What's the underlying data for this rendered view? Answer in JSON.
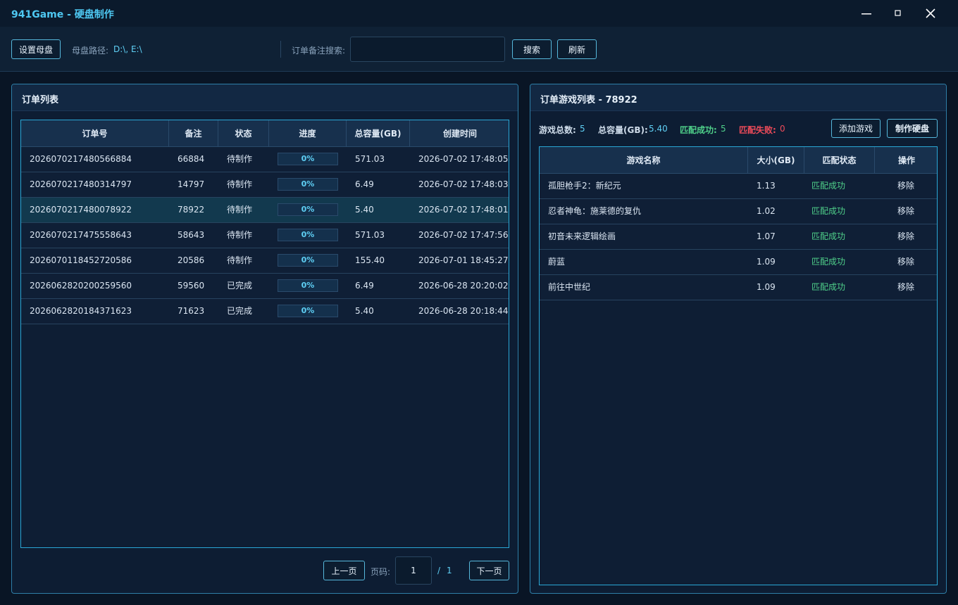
{
  "window": {
    "title": "941Game - 硬盘制作",
    "minimize_icon": "minimize-icon",
    "maximize_icon": "maximize-icon",
    "close_icon": "close-icon"
  },
  "toolbar": {
    "set_master_label": "设置母盘",
    "master_path_label": "母盘路径:",
    "master_path_value": "D:\\, E:\\",
    "search_label": "订单备注搜索:",
    "search_value": "",
    "search_button": "搜索",
    "refresh_button": "刷新"
  },
  "orders": {
    "title": "订单列表",
    "columns": [
      "订单号",
      "备注",
      "状态",
      "进度",
      "总容量(GB)",
      "创建时间"
    ],
    "selected_index": 2,
    "rows": [
      {
        "order_no": "2026070217480566884",
        "note": "66884",
        "status": "待制作",
        "progress": "0%",
        "progress_value": 0,
        "capacity": "571.03",
        "created": "2026-07-02 17:48:05"
      },
      {
        "order_no": "2026070217480314797",
        "note": "14797",
        "status": "待制作",
        "progress": "0%",
        "progress_value": 0,
        "capacity": "6.49",
        "created": "2026-07-02 17:48:03"
      },
      {
        "order_no": "2026070217480078922",
        "note": "78922",
        "status": "待制作",
        "progress": "0%",
        "progress_value": 0,
        "capacity": "5.40",
        "created": "2026-07-02 17:48:01"
      },
      {
        "order_no": "2026070217475558643",
        "note": "58643",
        "status": "待制作",
        "progress": "0%",
        "progress_value": 0,
        "capacity": "571.03",
        "created": "2026-07-02 17:47:56"
      },
      {
        "order_no": "2026070118452720586",
        "note": "20586",
        "status": "待制作",
        "progress": "0%",
        "progress_value": 0,
        "capacity": "155.40",
        "created": "2026-07-01 18:45:27"
      },
      {
        "order_no": "2026062820200259560",
        "note": "59560",
        "status": "已完成",
        "progress": "0%",
        "progress_value": 0,
        "capacity": "6.49",
        "created": "2026-06-28 20:20:02"
      },
      {
        "order_no": "2026062820184371623",
        "note": "71623",
        "status": "已完成",
        "progress": "0%",
        "progress_value": 0,
        "capacity": "5.40",
        "created": "2026-06-28 20:18:44"
      }
    ],
    "pager": {
      "prev_label": "上一页",
      "page_label": "页码:",
      "current_page": "1",
      "separator": "/",
      "total_pages": "1",
      "next_label": "下一页"
    }
  },
  "games": {
    "title": "订单游戏列表 - 78922",
    "stats": {
      "total_label": "游戏总数:",
      "total_value": "5",
      "capacity_label": "总容量(GB):",
      "capacity_value": "5.40",
      "match_ok_label": "匹配成功:",
      "match_ok_value": "5",
      "match_fail_label": "匹配失败:",
      "match_fail_value": "0"
    },
    "add_game_label": "添加游戏",
    "make_disk_label": "制作硬盘",
    "columns": [
      "游戏名称",
      "大小(GB)",
      "匹配状态",
      "操作"
    ],
    "rows": [
      {
        "name": "孤胆枪手2：新纪元",
        "size": "1.13",
        "match": "匹配成功",
        "action": "移除"
      },
      {
        "name": "忍者神龟：施莱德的复仇",
        "size": "1.02",
        "match": "匹配成功",
        "action": "移除"
      },
      {
        "name": "初音未来逻辑绘画",
        "size": "1.07",
        "match": "匹配成功",
        "action": "移除"
      },
      {
        "name": "蔚蓝",
        "size": "1.09",
        "match": "匹配成功",
        "action": "移除"
      },
      {
        "name": "前往中世纪",
        "size": "1.09",
        "match": "匹配成功",
        "action": "移除"
      }
    ]
  },
  "colors": {
    "accent": "#5fd0f5",
    "success": "#4fd08a",
    "danger": "#ef4b5a",
    "background": "#091525",
    "border": "#2aa7d6"
  }
}
